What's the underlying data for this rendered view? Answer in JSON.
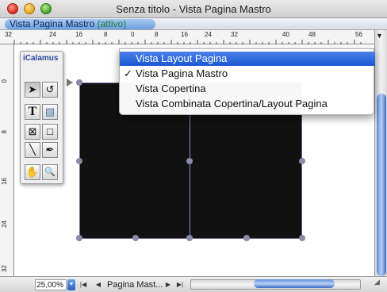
{
  "window": {
    "title": "Senza titolo - Vista Pagina Mastro"
  },
  "label_bar": {
    "page_label": "Vista Pagina Mastro",
    "state": "(attivo)"
  },
  "rulers": {
    "horizontal": [
      "32",
      "24",
      "16",
      "8",
      "0",
      "8",
      "16",
      "24",
      "32",
      "40",
      "48",
      "56"
    ],
    "vertical": [
      "0",
      "8",
      "16",
      "24",
      "32"
    ]
  },
  "palette": {
    "title": "iCalamus",
    "tools": [
      {
        "name": "pointer-tool",
        "glyph": "➤"
      },
      {
        "name": "rotate-tool",
        "glyph": "↺"
      },
      {
        "name": "text-tool",
        "glyph": "T"
      },
      {
        "name": "image-tool",
        "glyph": "▧"
      },
      {
        "name": "image-frame-tool",
        "glyph": "⊠"
      },
      {
        "name": "rectangle-tool",
        "glyph": "□"
      },
      {
        "name": "line-tool",
        "glyph": "╲"
      },
      {
        "name": "pen-tool",
        "glyph": "✒"
      },
      {
        "name": "hand-tool",
        "glyph": "✋"
      },
      {
        "name": "zoom-tool",
        "glyph": "🔍"
      }
    ]
  },
  "menu": {
    "items": [
      {
        "label": "Vista Layout Pagina",
        "checked": false,
        "highlighted": true
      },
      {
        "label": "Vista Pagina Mastro",
        "checked": true,
        "highlighted": false
      },
      {
        "label": "Vista Copertina",
        "checked": false,
        "highlighted": false
      },
      {
        "label": "Vista Combinata Copertina/Layout Pagina",
        "checked": false,
        "highlighted": false
      }
    ],
    "check_glyph": "✓"
  },
  "bottom_bar": {
    "zoom": "25,00%",
    "page": "Pagina Mast..."
  }
}
